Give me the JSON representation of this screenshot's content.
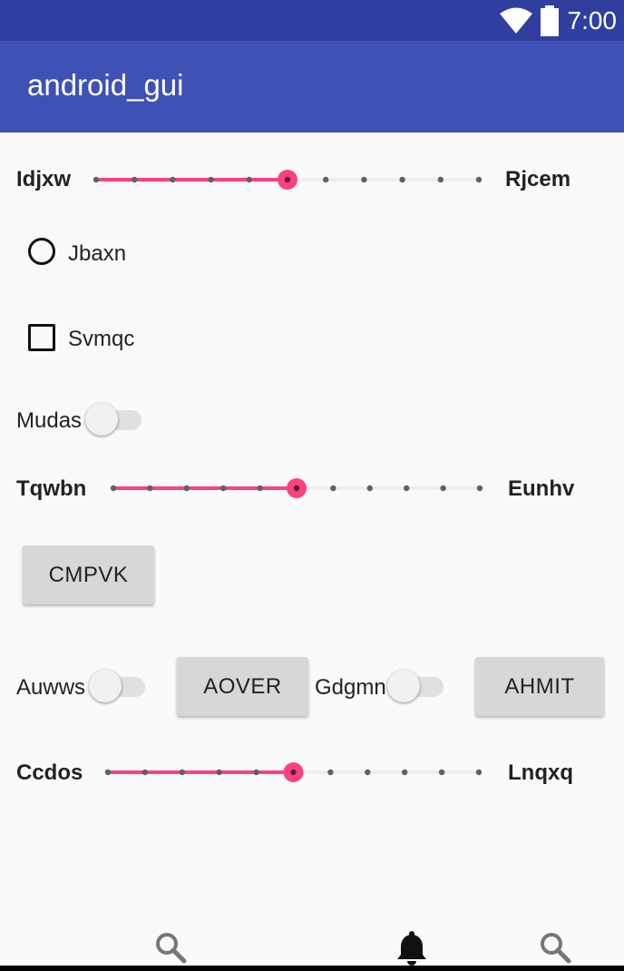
{
  "status_bar": {
    "time": "7:00"
  },
  "app_bar": {
    "title": "android_gui"
  },
  "slider1": {
    "left_label": "Idjxw",
    "right_label": "Rjcem",
    "value": 5,
    "max": 10
  },
  "radio": {
    "label": "Jbaxn",
    "checked": false
  },
  "checkbox": {
    "label": "Svmqc",
    "checked": false
  },
  "switch1": {
    "label": "Mudas",
    "on": false
  },
  "slider2": {
    "left_label": "Tqwbn",
    "right_label": "Eunhv",
    "value": 5,
    "max": 10
  },
  "button1": {
    "label": "CMPVK"
  },
  "row": {
    "switch_a": {
      "label": "Auwws",
      "on": false
    },
    "button_a": {
      "label": "AOVER"
    },
    "switch_b": {
      "label": "Gdgmn",
      "on": false
    },
    "button_b": {
      "label": "AHMIT"
    }
  },
  "slider3": {
    "left_label": "Ccdos",
    "right_label": "Lnqxq",
    "value": 5,
    "max": 10
  },
  "bottom_nav": {
    "items": [
      "search-icon",
      "bell-icon",
      "search-icon"
    ]
  },
  "colors": {
    "accent": "#ff4081",
    "primary": "#3f51b5",
    "primary_dark": "#303f9f"
  }
}
